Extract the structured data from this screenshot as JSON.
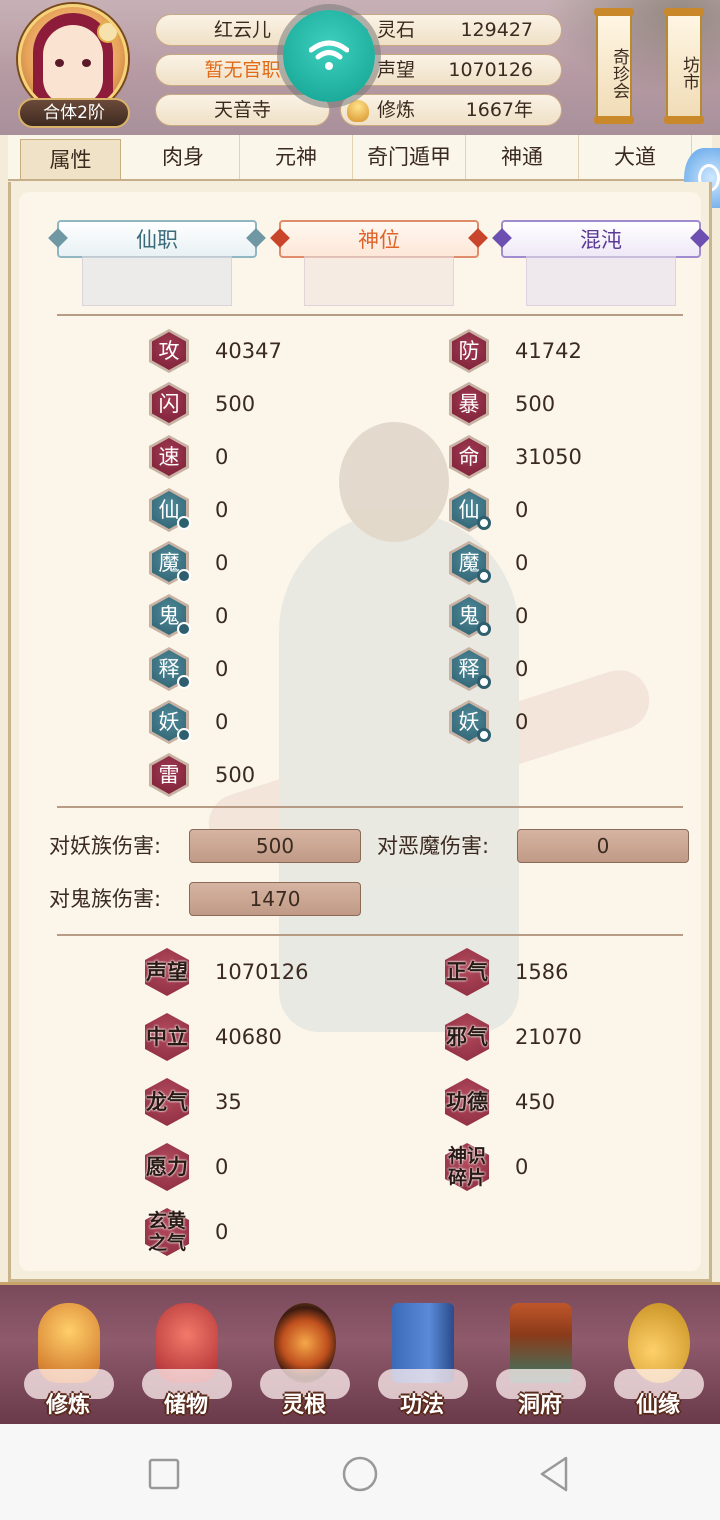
{
  "player": {
    "name": "红云儿",
    "title": "暂无官职",
    "sect": "天音寺",
    "rank": "合体2阶"
  },
  "currencies": {
    "spirit_stone": {
      "label": "灵石",
      "value": "129427",
      "icon": "spirit-stone-icon"
    },
    "reputation": {
      "label": "声望",
      "value": "1070126",
      "icon": "ear-icon"
    },
    "cultivation": {
      "label": "修炼",
      "value": "1667年",
      "icon": "meditation-icon"
    }
  },
  "top_buttons": {
    "treasure": "奇珍会",
    "market": "坊市"
  },
  "tabs": [
    "属性",
    "肉身",
    "元神",
    "奇门遁甲",
    "神通",
    "大道"
  ],
  "active_tab": 0,
  "banners": {
    "xianzhi": "仙职",
    "shenwei": "神位",
    "hundun": "混沌"
  },
  "stats_left": [
    {
      "glyph": "攻",
      "value": "40347"
    },
    {
      "glyph": "闪",
      "value": "500"
    },
    {
      "glyph": "速",
      "value": "0"
    },
    {
      "glyph": "仙",
      "value": "0"
    },
    {
      "glyph": "魔",
      "value": "0"
    },
    {
      "glyph": "鬼",
      "value": "0"
    },
    {
      "glyph": "释",
      "value": "0"
    },
    {
      "glyph": "妖",
      "value": "0"
    },
    {
      "glyph": "雷",
      "value": "500"
    }
  ],
  "stats_right": [
    {
      "glyph": "防",
      "value": "41742"
    },
    {
      "glyph": "暴",
      "value": "500"
    },
    {
      "glyph": "命",
      "value": "31050"
    },
    {
      "glyph": "仙",
      "value": "0"
    },
    {
      "glyph": "魔",
      "value": "0"
    },
    {
      "glyph": "鬼",
      "value": "0"
    },
    {
      "glyph": "释",
      "value": "0"
    },
    {
      "glyph": "妖",
      "value": "0"
    }
  ],
  "damage": {
    "demon_race": {
      "label": "对妖族伤害:",
      "value": "500"
    },
    "evil_demon": {
      "label": "对恶魔伤害:",
      "value": "0"
    },
    "ghost_race": {
      "label": "对鬼族伤害:",
      "value": "1470"
    }
  },
  "reputation_stats": {
    "left": [
      {
        "label": "声望",
        "value": "1070126"
      },
      {
        "label": "中立",
        "value": "40680"
      },
      {
        "label": "龙气",
        "value": "35"
      },
      {
        "label": "愿力",
        "value": "0"
      },
      {
        "label": "玄黄之气",
        "value": "0"
      }
    ],
    "right": [
      {
        "label": "正气",
        "value": "1586"
      },
      {
        "label": "邪气",
        "value": "21070"
      },
      {
        "label": "功德",
        "value": "450"
      },
      {
        "label": "神识碎片",
        "value": "0"
      }
    ]
  },
  "bottom_nav": [
    "修炼",
    "储物",
    "灵根",
    "功法",
    "洞府",
    "仙缘"
  ],
  "colors": {
    "accent_orange": "#e06a16",
    "stat_badge_red": "#7a1f36",
    "stat_badge_blue": "#2d5f6e",
    "wifi_teal": "#11a08f"
  }
}
